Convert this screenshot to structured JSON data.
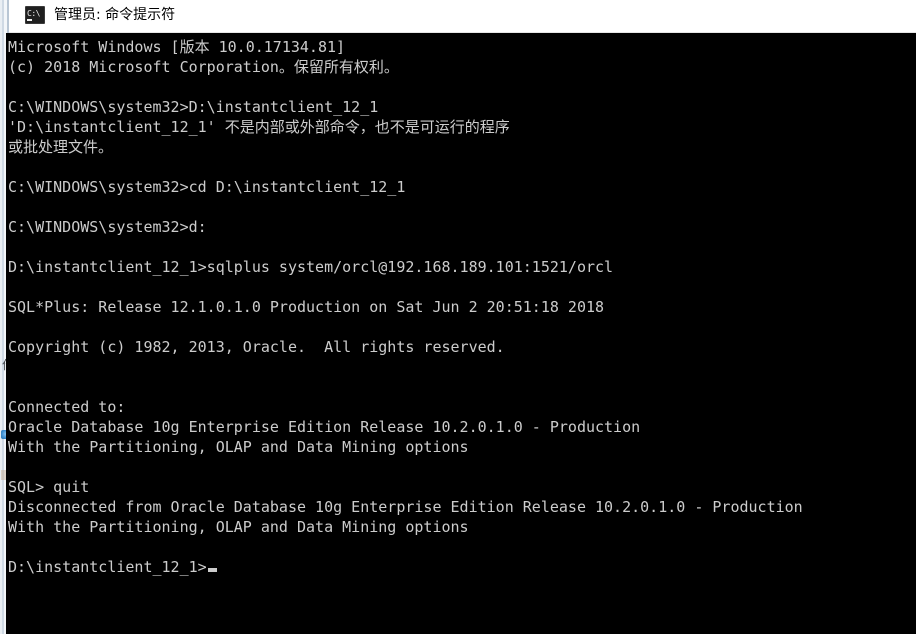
{
  "window": {
    "title": "管理员: 命令提示符",
    "icon": "cmd-console-icon",
    "background_color": "#000000",
    "text_color": "#cccccc",
    "titlebar_color": "#ffffff"
  },
  "console": {
    "lines": [
      "Microsoft Windows [版本 10.0.17134.81]",
      "(c) 2018 Microsoft Corporation。保留所有权利。",
      "",
      "C:\\WINDOWS\\system32>D:\\instantclient_12_1",
      "'D:\\instantclient_12_1' 不是内部或外部命令，也不是可运行的程序",
      "或批处理文件。",
      "",
      "C:\\WINDOWS\\system32>cd D:\\instantclient_12_1",
      "",
      "C:\\WINDOWS\\system32>d:",
      "",
      "D:\\instantclient_12_1>sqlplus system/orcl@192.168.189.101:1521/orcl",
      "",
      "SQL*Plus: Release 12.1.0.1.0 Production on Sat Jun 2 20:51:18 2018",
      "",
      "Copyright (c) 1982, 2013, Oracle.  All rights reserved.",
      "",
      "",
      "Connected to:",
      "Oracle Database 10g Enterprise Edition Release 10.2.0.1.0 - Production",
      "With the Partitioning, OLAP and Data Mining options",
      "",
      "SQL> quit",
      "Disconnected from Oracle Database 10g Enterprise Edition Release 10.2.0.1.0 - Production",
      "With the Partitioning, OLAP and Data Mining options",
      "",
      "D:\\instantclient_12_1>"
    ],
    "prompt_line_index": 26,
    "cursor_visible": true
  },
  "background_window": {
    "fragment_text": "作",
    "icon": "blue-app-icon"
  }
}
